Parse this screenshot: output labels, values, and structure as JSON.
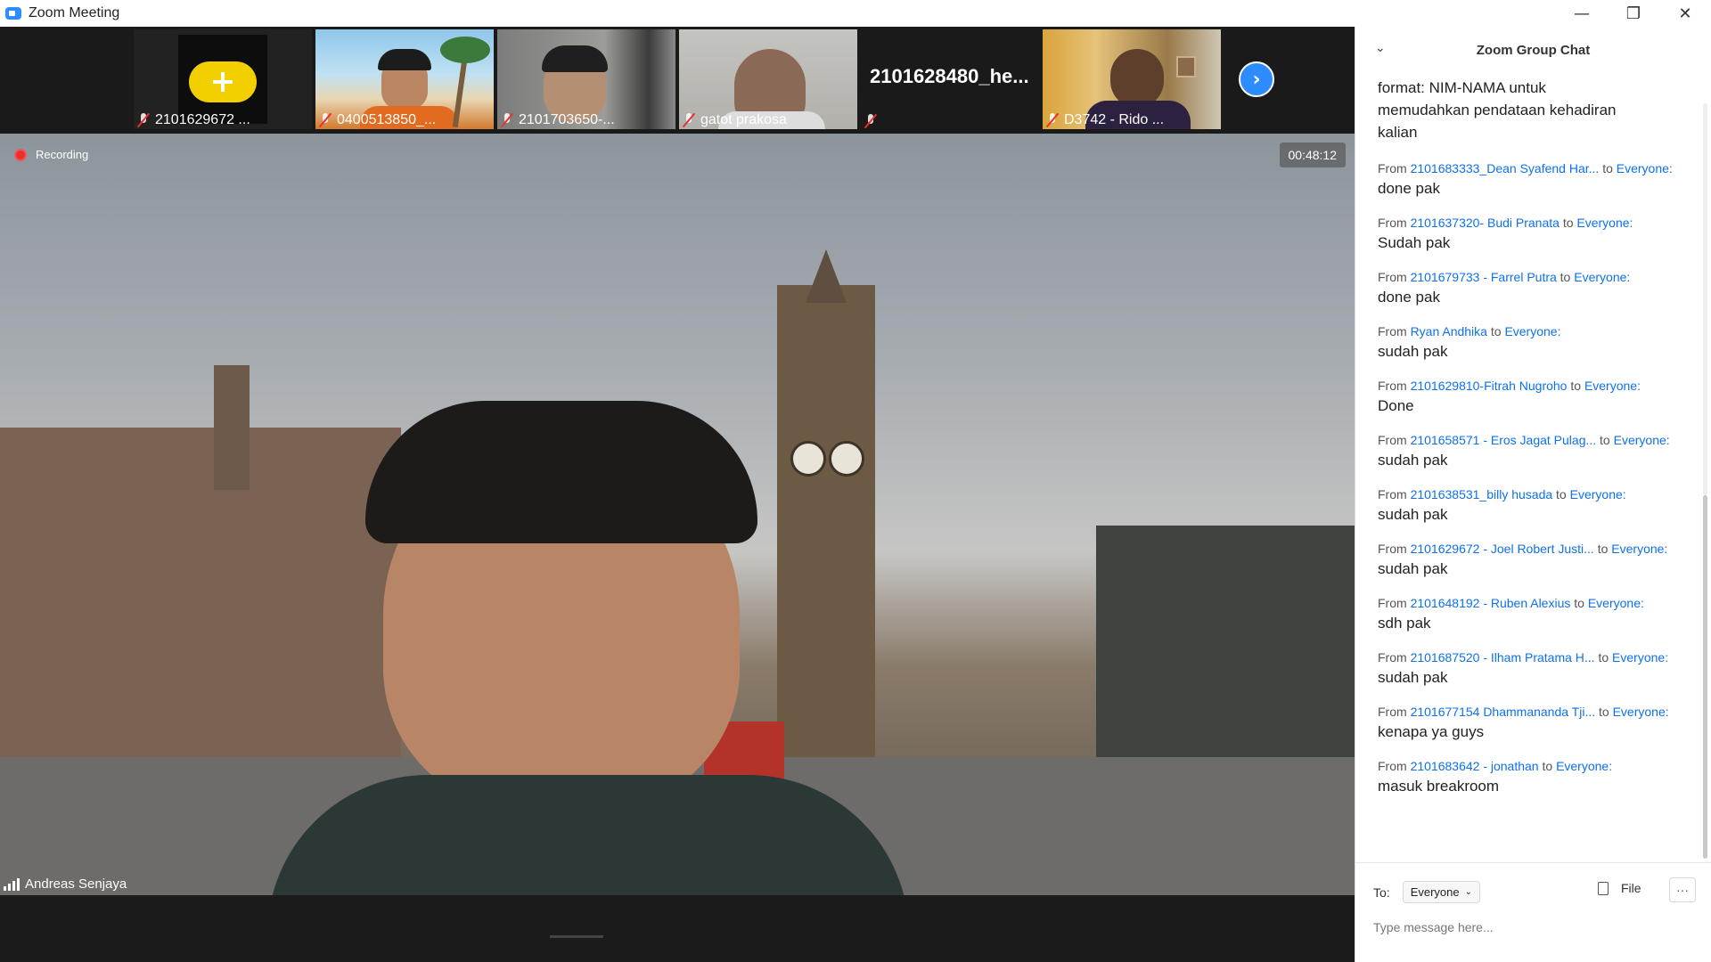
{
  "window": {
    "title": "Zoom Meeting",
    "minimize": "—",
    "restore": "❐",
    "close": "✕"
  },
  "participants": [
    {
      "name": "2101629672 ...",
      "muted": true,
      "type": "avatar"
    },
    {
      "name": "0400513850_...",
      "muted": true,
      "type": "video"
    },
    {
      "name": "2101703650-...",
      "muted": true,
      "type": "video"
    },
    {
      "name": "gatot prakosa",
      "muted": true,
      "type": "video"
    },
    {
      "name": "2101628480_he...",
      "muted": true,
      "type": "name-only"
    },
    {
      "name": "D3742 - Rido ...",
      "muted": true,
      "type": "video"
    }
  ],
  "next_page": "›",
  "main_video": {
    "recording_label": "Recording",
    "timer": "00:48:12",
    "speaker_name": "Andreas Senjaya"
  },
  "chat": {
    "title": "Zoom Group Chat",
    "collapse": "⌄",
    "intro": "format: NIM-NAMA untuk\nmemudahkan pendataan kehadiran\nkalian",
    "messages": [
      {
        "from": "2101683333_Dean Syafend Har...",
        "to": "Everyone:",
        "text": "done pak"
      },
      {
        "from": "2101637320- Budi Pranata",
        "to": "Everyone:",
        "text": "Sudah pak"
      },
      {
        "from": "2101679733 - Farrel Putra",
        "to": "Everyone:",
        "text": "done pak"
      },
      {
        "from": "Ryan Andhika",
        "to": "Everyone:",
        "text": "sudah pak"
      },
      {
        "from": "2101629810-Fitrah Nugroho",
        "to": "Everyone:",
        "text": "Done"
      },
      {
        "from": "2101658571 - Eros Jagat Pulag...",
        "to": "Everyone:",
        "text": "sudah pak"
      },
      {
        "from": "2101638531_billy husada",
        "to": "Everyone:",
        "text": "sudah pak"
      },
      {
        "from": "2101629672 - Joel Robert Justi...",
        "to": "Everyone:",
        "text": "sudah pak"
      },
      {
        "from": "2101648192 - Ruben Alexius",
        "to": "Everyone:",
        "text": "sdh pak"
      },
      {
        "from": "2101687520 - Ilham Pratama H...",
        "to": "Everyone:",
        "text": "sudah pak"
      },
      {
        "from": "2101677154 Dhammananda Tji...",
        "to": "Everyone:",
        "text": "kenapa ya guys"
      },
      {
        "from": "2101683642 - jonathan",
        "to": "Everyone:",
        "text": "masuk breakroom"
      }
    ],
    "from_word": "From",
    "to_word": "to",
    "footer": {
      "to_label": "To:",
      "recipient": "Everyone",
      "file_label": "File",
      "more_label": "···",
      "placeholder": "Type message here..."
    }
  },
  "colors": {
    "accent": "#2d8cff",
    "link": "#0e71eb",
    "recording": "#e8302f",
    "avatar_yellow": "#f2d000"
  }
}
